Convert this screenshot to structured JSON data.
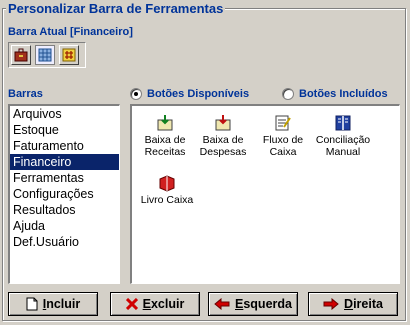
{
  "window": {
    "title": "Personalizar Barra de Ferramentas"
  },
  "current_bar": {
    "label": "Barra Atual [Financeiro]",
    "buttons": [
      {
        "icon": "briefcase-icon",
        "state": "normal"
      },
      {
        "icon": "grid-icon",
        "state": "selected"
      },
      {
        "icon": "hash-icon",
        "state": "normal"
      }
    ]
  },
  "bars": {
    "label": "Barras",
    "items": [
      "Arquivos",
      "Estoque",
      "Faturamento",
      "Financeiro",
      "Ferramentas",
      "Configurações",
      "Resultados",
      "Ajuda",
      "Def.Usuário"
    ],
    "selected": "Financeiro"
  },
  "view_options": {
    "available": {
      "label": "Botões Disponíveis",
      "checked": true
    },
    "included": {
      "label": "Botões Incluídos",
      "checked": false
    }
  },
  "available_buttons": [
    {
      "line1": "Baixa de",
      "line2": "Receitas",
      "icon": "receipt-in-icon"
    },
    {
      "line1": "Baixa de",
      "line2": "Despesas",
      "icon": "receipt-out-icon"
    },
    {
      "line1": "Fluxo de",
      "line2": "Caixa",
      "icon": "cashflow-icon"
    },
    {
      "line1": "Conciliação",
      "line2": "Manual",
      "icon": "ledger-icon"
    },
    {
      "line1": "Livro Caixa",
      "line2": "",
      "icon": "cashbook-icon"
    }
  ],
  "actions": {
    "include": {
      "first": "I",
      "rest": "ncluir",
      "icon": "new-page-icon"
    },
    "delete": {
      "first": "E",
      "rest": "xcluir",
      "icon": "red-x-icon"
    },
    "left": {
      "first": "E",
      "rest": "squerda",
      "icon": "arrow-left-icon"
    },
    "right": {
      "first": "D",
      "rest": "ireita",
      "icon": "arrow-right-icon"
    }
  },
  "colors": {
    "label_blue": "#003399",
    "selection": "#0a246a",
    "face": "#d4d0c8"
  }
}
